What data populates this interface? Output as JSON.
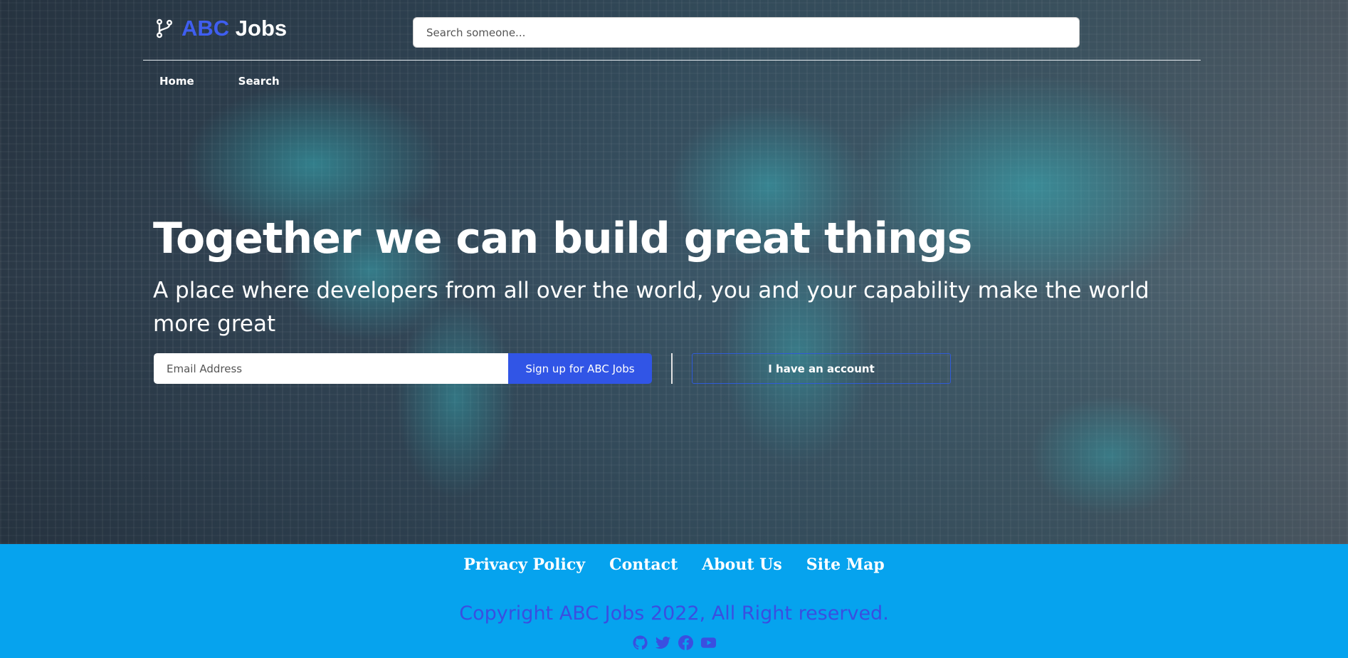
{
  "header": {
    "brand_prefix": "ABC",
    "brand_suffix": " Jobs",
    "search_placeholder": "Search someone..."
  },
  "nav": [
    {
      "label": "Home"
    },
    {
      "label": "Search"
    }
  ],
  "hero": {
    "headline": "Together we can build great things",
    "subline": "A place where developers from all over the world, you and your capability make the world more great",
    "email_placeholder": "Email Address",
    "signup_label": "Sign up for ABC Jobs",
    "account_label": "I have an account"
  },
  "footer": {
    "links": [
      {
        "label": "Privacy Policy"
      },
      {
        "label": "Contact"
      },
      {
        "label": "About Us"
      },
      {
        "label": "Site Map"
      }
    ],
    "copyright": "Copyright ABC Jobs 2022, All Right reserved.",
    "social_icons": [
      "github-icon",
      "twitter-icon",
      "facebook-icon",
      "youtube-icon"
    ]
  },
  "colors": {
    "brand_blue": "#3f5ef0",
    "button_blue": "#3155e6",
    "footer_bg": "#06a3ee",
    "copyright_text": "#3a4fe0"
  }
}
